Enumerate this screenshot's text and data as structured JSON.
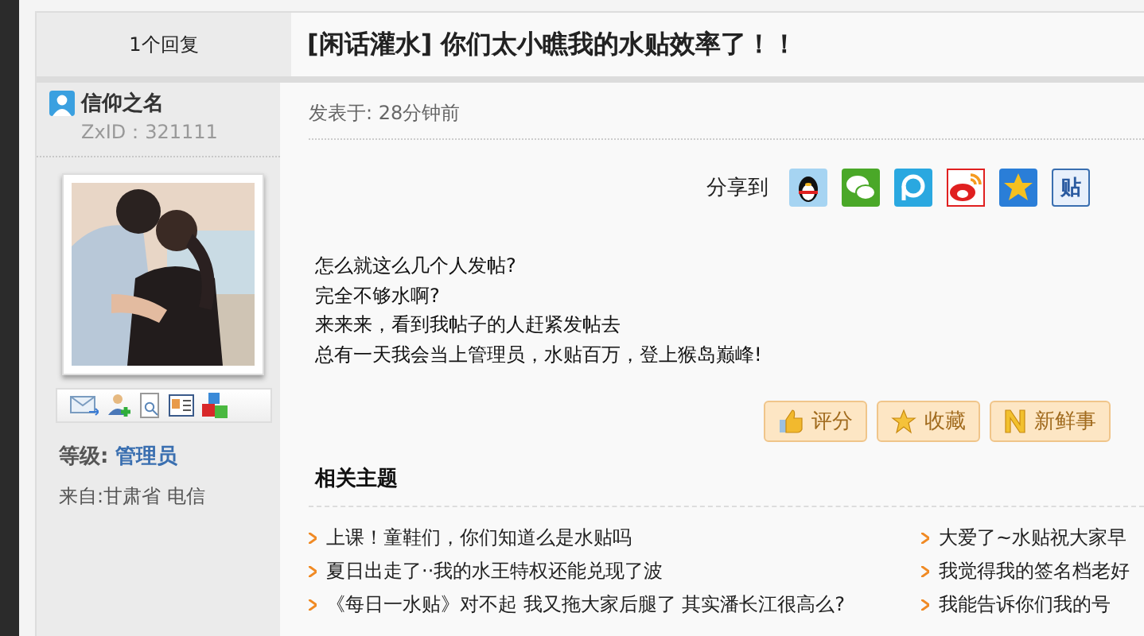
{
  "reply_count": "1个回复",
  "title": "[闲话灌水] 你们太小瞧我的水贴效率了！！",
  "author": {
    "name": "信仰之名",
    "zxid": "ZxID：321111",
    "level_label": "等级:",
    "level": "管理员",
    "from": "来自:甘肃省 电信"
  },
  "posted": "发表于: 28分钟前",
  "share": {
    "label": "分享到",
    "tieba_text": "贴"
  },
  "body": [
    "怎么就这么几个人发帖?",
    "完全不够水啊?",
    "来来来，看到我帖子的人赶紧发帖去",
    "总有一天我会当上管理员，水贴百万，登上猴岛巅峰!"
  ],
  "actions": [
    {
      "kind": "thumb",
      "label": "评分"
    },
    {
      "kind": "star",
      "label": "收藏"
    },
    {
      "kind": "news",
      "label": "新鲜事"
    }
  ],
  "related": {
    "title": "相关主题",
    "left": [
      "上课！童鞋们，你们知道么是水贴吗",
      "夏日出走了··我的水王特权还能兑现了波",
      "《每日一水贴》对不起  我又拖大家后腿了   其实潘长江很高么?"
    ],
    "right": [
      "大爱了~水贴祝大家早",
      "我觉得我的签名档老好",
      "我能告诉你们我的号"
    ]
  }
}
